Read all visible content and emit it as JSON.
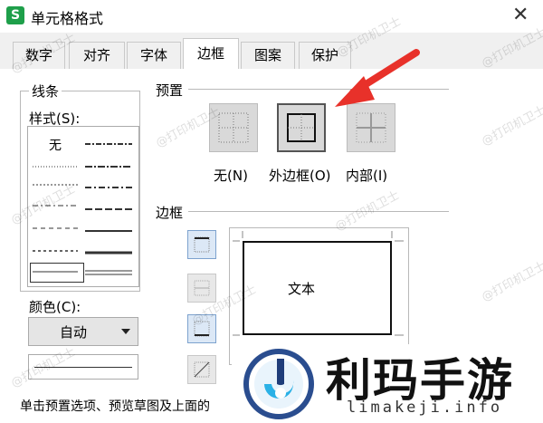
{
  "window": {
    "app_icon": "S",
    "title": "单元格格式",
    "close_glyph": "✕"
  },
  "tabs": [
    {
      "label": "数字",
      "active": false
    },
    {
      "label": "对齐",
      "active": false
    },
    {
      "label": "字体",
      "active": false
    },
    {
      "label": "边框",
      "active": true
    },
    {
      "label": "图案",
      "active": false
    },
    {
      "label": "保护",
      "active": false
    }
  ],
  "line_group": {
    "title": "线条",
    "style_label": "样式(S):",
    "style_none": "无",
    "color_label": "颜色(C):",
    "color_value": "自动"
  },
  "presets": {
    "title": "预置",
    "items": [
      {
        "label": "无(N)",
        "icon": "border-none-icon"
      },
      {
        "label": "外边框(O)",
        "icon": "border-outline-icon"
      },
      {
        "label": "内部(I)",
        "icon": "border-inside-icon"
      }
    ]
  },
  "border": {
    "title": "边框",
    "preview_text": "文本",
    "side_buttons": [
      "border-top-icon",
      "border-horizontal-icon",
      "border-bottom-icon",
      "border-diagonal-icon"
    ]
  },
  "hint": "单击预置选项、预览草图及上面的",
  "watermark": "@打印机卫士",
  "overlay": {
    "name": "利玛手游",
    "url": "limakeji.info"
  },
  "annotation": {
    "arrow_color": "#e8312a"
  }
}
